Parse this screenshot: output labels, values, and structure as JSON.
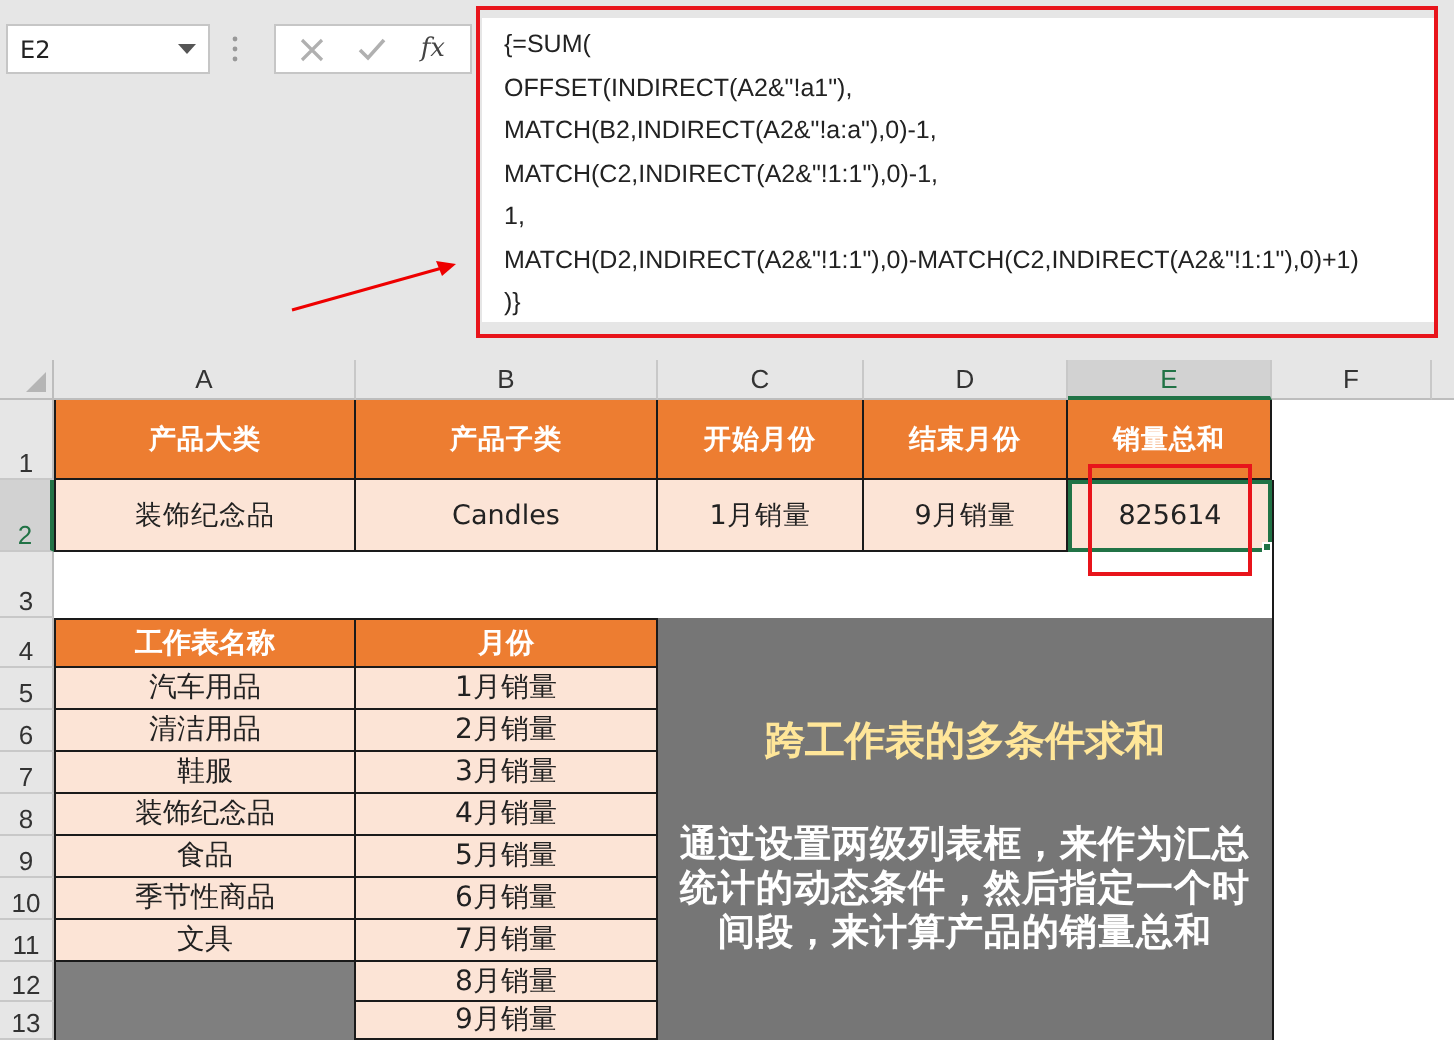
{
  "name_box": {
    "value": "E2"
  },
  "formula_bar": {
    "function_button": "fx",
    "lines": [
      "{=SUM(",
      "OFFSET(INDIRECT(A2&\"!a1\"),",
      "MATCH(B2,INDIRECT(A2&\"!a:a\"),0)-1,",
      "MATCH(C2,INDIRECT(A2&\"!1:1\"),0)-1,",
      "1,",
      "MATCH(D2,INDIRECT(A2&\"!1:1\"),0)-MATCH(C2,INDIRECT(A2&\"!1:1\"),0)+1)",
      ")}"
    ]
  },
  "columns": [
    {
      "label": "A",
      "selected": false
    },
    {
      "label": "B",
      "selected": false
    },
    {
      "label": "C",
      "selected": false
    },
    {
      "label": "D",
      "selected": false
    },
    {
      "label": "E",
      "selected": true
    },
    {
      "label": "F",
      "selected": false
    }
  ],
  "rows": [
    {
      "label": "1",
      "selected": false
    },
    {
      "label": "2",
      "selected": true
    },
    {
      "label": "3",
      "selected": false
    },
    {
      "label": "4",
      "selected": false
    },
    {
      "label": "5",
      "selected": false
    },
    {
      "label": "6",
      "selected": false
    },
    {
      "label": "7",
      "selected": false
    },
    {
      "label": "8",
      "selected": false
    },
    {
      "label": "9",
      "selected": false
    },
    {
      "label": "10",
      "selected": false
    },
    {
      "label": "11",
      "selected": false
    },
    {
      "label": "12",
      "selected": false
    },
    {
      "label": "13",
      "selected": false
    }
  ],
  "summary": {
    "headers": [
      "产品大类",
      "产品子类",
      "开始月份",
      "结束月份",
      "销量总和"
    ],
    "values": [
      {
        "text": "装饰纪念品",
        "selected": false
      },
      {
        "text": "Candles",
        "selected": false
      },
      {
        "text": "1月销量",
        "selected": false
      },
      {
        "text": "9月销量",
        "selected": false
      },
      {
        "text": "825614",
        "selected": true
      }
    ]
  },
  "list_table": {
    "headers": [
      "工作表名称",
      "月份"
    ],
    "rows": [
      {
        "sheet": "汽车用品",
        "month": "1月销量"
      },
      {
        "sheet": "清洁用品",
        "month": "2月销量"
      },
      {
        "sheet": "鞋服",
        "month": "3月销量"
      },
      {
        "sheet": "装饰纪念品",
        "month": "4月销量"
      },
      {
        "sheet": "食品",
        "month": "5月销量"
      },
      {
        "sheet": "季节性商品",
        "month": "6月销量"
      },
      {
        "sheet": "文具",
        "month": "7月销量"
      },
      {
        "month": "8月销量"
      },
      {
        "month": "9月销量"
      }
    ]
  },
  "note": {
    "title": "跨工作表的多条件求和",
    "body": "通过设置两级列表框，来作为汇总统计的动态条件，然后指定一个时间段，来计算产品的销量总和"
  }
}
